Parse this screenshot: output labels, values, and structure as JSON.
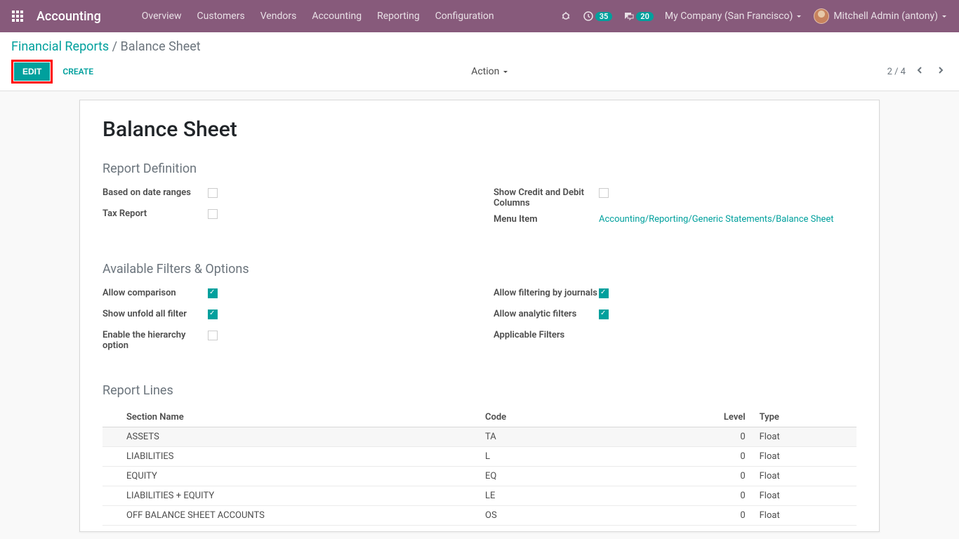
{
  "topbar": {
    "brand": "Accounting",
    "nav": [
      "Overview",
      "Customers",
      "Vendors",
      "Accounting",
      "Reporting",
      "Configuration"
    ],
    "badge_clock": "35",
    "badge_chat": "20",
    "company": "My Company (San Francisco)",
    "user": "Mitchell Admin (antony)"
  },
  "breadcrumb": {
    "parent": "Financial Reports",
    "current": "Balance Sheet"
  },
  "cp": {
    "edit": "EDIT",
    "create": "CREATE",
    "action": "Action",
    "pager": "2 / 4"
  },
  "form": {
    "title": "Balance Sheet",
    "section_def": "Report Definition",
    "based_on": "Based on date ranges",
    "tax_report": "Tax Report",
    "show_credit": "Show Credit and Debit Columns",
    "menu_item_label": "Menu Item",
    "menu_item_value": "Accounting/Reporting/Generic Statements/Balance Sheet",
    "section_filters": "Available Filters & Options",
    "allow_comparison": "Allow comparison",
    "show_unfold": "Show unfold all filter",
    "enable_hierarchy": "Enable the hierarchy option",
    "allow_journals": "Allow filtering by journals",
    "allow_analytic": "Allow analytic filters",
    "applicable_filters": "Applicable Filters",
    "section_lines": "Report Lines",
    "columns": {
      "section": "Section Name",
      "code": "Code",
      "level": "Level",
      "type": "Type"
    },
    "lines": [
      {
        "name": "ASSETS",
        "code": "TA",
        "level": "0",
        "type": "Float"
      },
      {
        "name": "LIABILITIES",
        "code": "L",
        "level": "0",
        "type": "Float"
      },
      {
        "name": "EQUITY",
        "code": "EQ",
        "level": "0",
        "type": "Float"
      },
      {
        "name": "LIABILITIES + EQUITY",
        "code": "LE",
        "level": "0",
        "type": "Float"
      },
      {
        "name": "OFF BALANCE SHEET ACCOUNTS",
        "code": "OS",
        "level": "0",
        "type": "Float"
      }
    ]
  }
}
